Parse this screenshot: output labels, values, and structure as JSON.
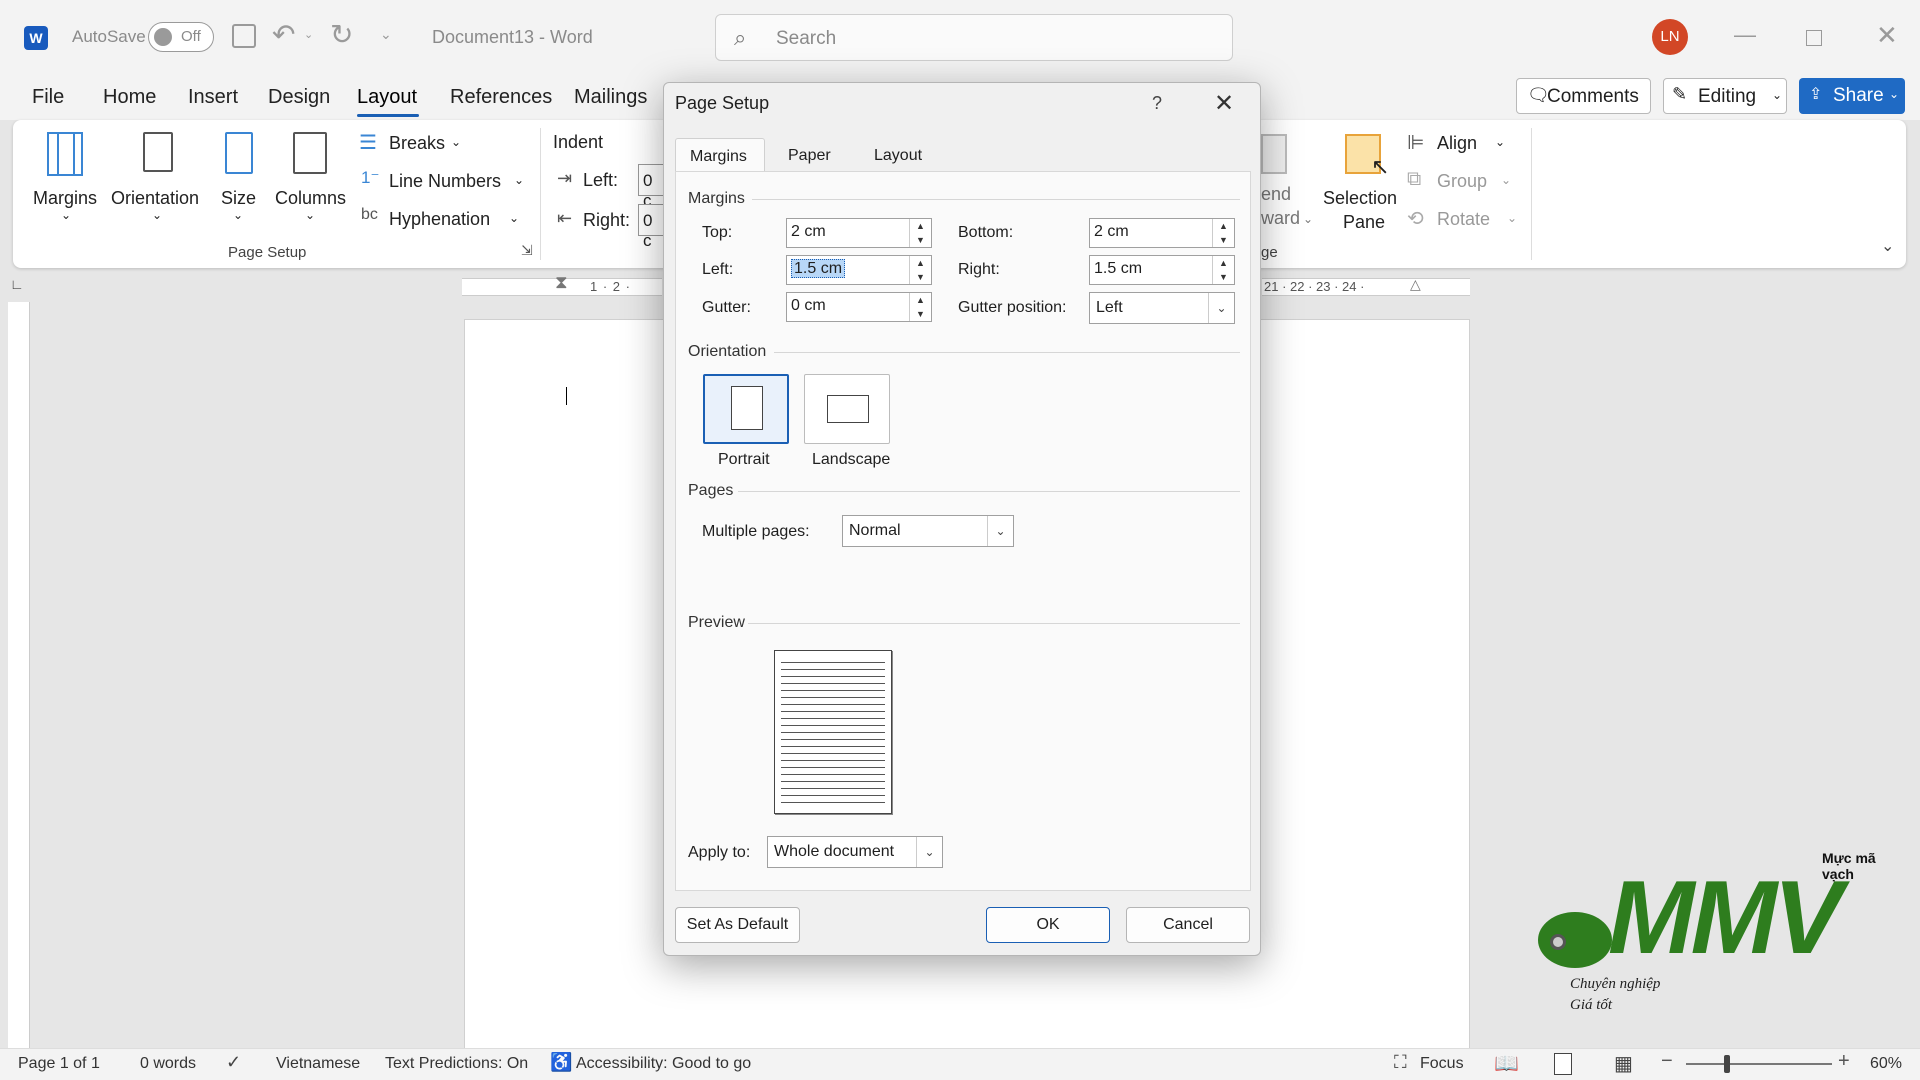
{
  "titlebar": {
    "autosave_label": "AutoSave",
    "autosave_state": "Off",
    "doc_title": "Document13 - Word",
    "search_placeholder": "Search",
    "avatar_initials": "LN"
  },
  "menu": {
    "tabs": [
      "File",
      "Home",
      "Insert",
      "Design",
      "Layout",
      "References",
      "Mailings"
    ],
    "comments": "Comments",
    "editing": "Editing",
    "share": "Share"
  },
  "ribbon": {
    "margins": "Margins",
    "orientation": "Orientation",
    "size": "Size",
    "columns": "Columns",
    "breaks": "Breaks",
    "line_numbers": "Line Numbers",
    "hyphenation": "Hyphenation",
    "page_setup_group": "Page Setup",
    "indent": "Indent",
    "indent_left": "Left:",
    "indent_right": "Right:",
    "indent_left_val": "0 c",
    "indent_right_val": "0 c",
    "send_backward_a": "end",
    "send_backward_b": "ward",
    "arrange_group": "ge",
    "selection_pane_a": "Selection",
    "selection_pane_b": "Pane",
    "align": "Align",
    "group": "Group",
    "rotate": "Rotate"
  },
  "ruler": {
    "left_nums": "1 · 2 ·",
    "right_nums": "21 · 22 · 23 · 24 ·"
  },
  "dialog": {
    "title": "Page Setup",
    "help": "?",
    "tabs": [
      "Margins",
      "Paper",
      "Layout"
    ],
    "margins_section": "Margins",
    "top_label": "Top:",
    "top_value": "2 cm",
    "bottom_label": "Bottom:",
    "bottom_value": "2 cm",
    "left_label": "Left:",
    "left_value": "1.5 cm",
    "right_label": "Right:",
    "right_value": "1.5 cm",
    "gutter_label": "Gutter:",
    "gutter_value": "0 cm",
    "gutter_pos_label": "Gutter position:",
    "gutter_pos_value": "Left",
    "orientation_section": "Orientation",
    "portrait": "Portrait",
    "landscape": "Landscape",
    "pages_section": "Pages",
    "multiple_pages_label": "Multiple pages:",
    "multiple_pages_value": "Normal",
    "preview_section": "Preview",
    "apply_to_label": "Apply to:",
    "apply_to_value": "Whole document",
    "set_default": "Set As Default",
    "ok": "OK",
    "cancel": "Cancel"
  },
  "watermark": {
    "top": "Mực mã vạch",
    "brand": "MMV",
    "line1": "Chuyên nghiệp",
    "line2": "Giá tốt"
  },
  "status": {
    "page": "Page 1 of 1",
    "words": "0 words",
    "language": "Vietnamese",
    "predictions": "Text Predictions: On",
    "accessibility": "Accessibility: Good to go",
    "focus": "Focus",
    "zoom": "60%"
  },
  "colors": {
    "accent": "#1a5fb4",
    "share_bg": "#1f6ac4",
    "avatar": "#d24726",
    "brand_green": "#2e7d1e"
  }
}
